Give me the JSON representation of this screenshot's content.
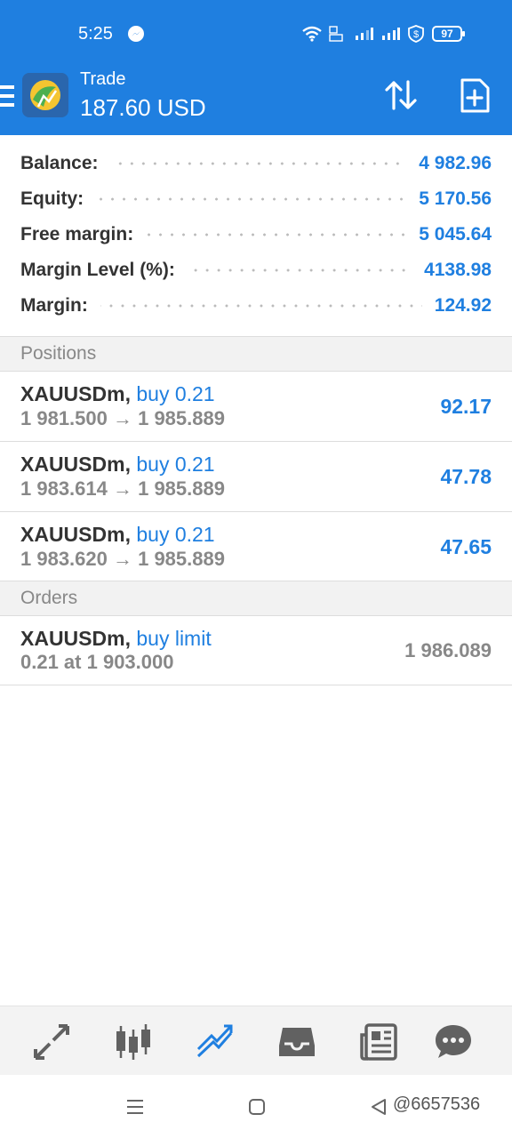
{
  "status_bar": {
    "time": "5:25",
    "battery": "97"
  },
  "header": {
    "title": "Trade",
    "balance": "187.60 USD"
  },
  "summary": [
    {
      "label": "Balance:",
      "value": "4 982.96"
    },
    {
      "label": "Equity:",
      "value": "5 170.56"
    },
    {
      "label": "Free margin:",
      "value": "5 045.64"
    },
    {
      "label": "Margin Level (%):",
      "value": "4138.98"
    },
    {
      "label": "Margin:",
      "value": "124.92"
    }
  ],
  "positions": {
    "title": "Positions",
    "items": [
      {
        "symbol": "XAUUSDm,",
        "type": "buy 0.21",
        "prices": "1 981.500 → 1 985.889",
        "profit": "92.17"
      },
      {
        "symbol": "XAUUSDm,",
        "type": "buy 0.21",
        "prices": "1 983.614 → 1 985.889",
        "profit": "47.78"
      },
      {
        "symbol": "XAUUSDm,",
        "type": "buy 0.21",
        "prices": "1 983.620 → 1 985.889",
        "profit": "47.65"
      }
    ]
  },
  "orders": {
    "title": "Orders",
    "items": [
      {
        "symbol": "XAUUSDm,",
        "type": "buy limit",
        "details": "0.21 at 1 903.000",
        "price": "1 986.089"
      }
    ]
  },
  "bottom_nav": {
    "items": [
      {
        "icon": "quotes-icon",
        "active": false
      },
      {
        "icon": "chart-icon",
        "active": false
      },
      {
        "icon": "trade-icon",
        "active": true
      },
      {
        "icon": "history-icon",
        "active": false
      },
      {
        "icon": "news-icon",
        "active": false
      },
      {
        "icon": "messages-icon",
        "active": false
      }
    ]
  },
  "watermark": "@6657536",
  "colors": {
    "accent": "#1f7fe0",
    "text": "#333333",
    "muted": "#888888"
  }
}
